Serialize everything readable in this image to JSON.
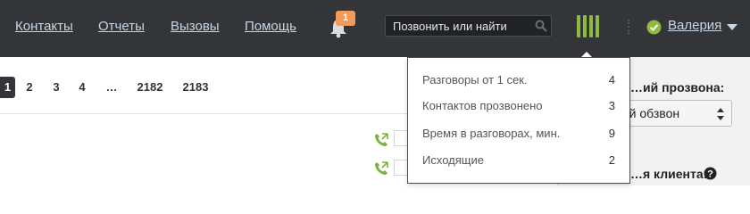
{
  "nav": {
    "items": [
      {
        "label": "Контакты"
      },
      {
        "label": "Отчеты"
      },
      {
        "label": "Вызовы"
      },
      {
        "label": "Помощь"
      }
    ],
    "notifications_count": "1",
    "search_placeholder": "Позвонить или найти",
    "user_name": "Валерия"
  },
  "pagination": {
    "pages": [
      "1",
      "2",
      "3",
      "4",
      "…",
      "2182",
      "2183"
    ],
    "current": "1"
  },
  "right_panel": {
    "dial_mode_label": "…ий прозвона:",
    "dial_mode_value": "…отный обзвон",
    "client_label": "…я клиента:"
  },
  "stats_popup": {
    "rows": [
      {
        "label": "Разговоры от 1 сек.",
        "value": "4"
      },
      {
        "label": "Контактов прозвонено",
        "value": "3"
      },
      {
        "label": "Время в разговорах, мин.",
        "value": "9"
      },
      {
        "label": "Исходящие",
        "value": "2"
      }
    ]
  },
  "colors": {
    "topbar": "#333538",
    "nav_link": "#c9d6e4",
    "accent_green": "#8dbb3f",
    "badge_orange": "#f29b59"
  },
  "icons": [
    "bell-icon",
    "search-icon",
    "stats-bars-icon",
    "status-ok-icon",
    "chevron-down-icon",
    "phone-icon",
    "help-icon"
  ]
}
